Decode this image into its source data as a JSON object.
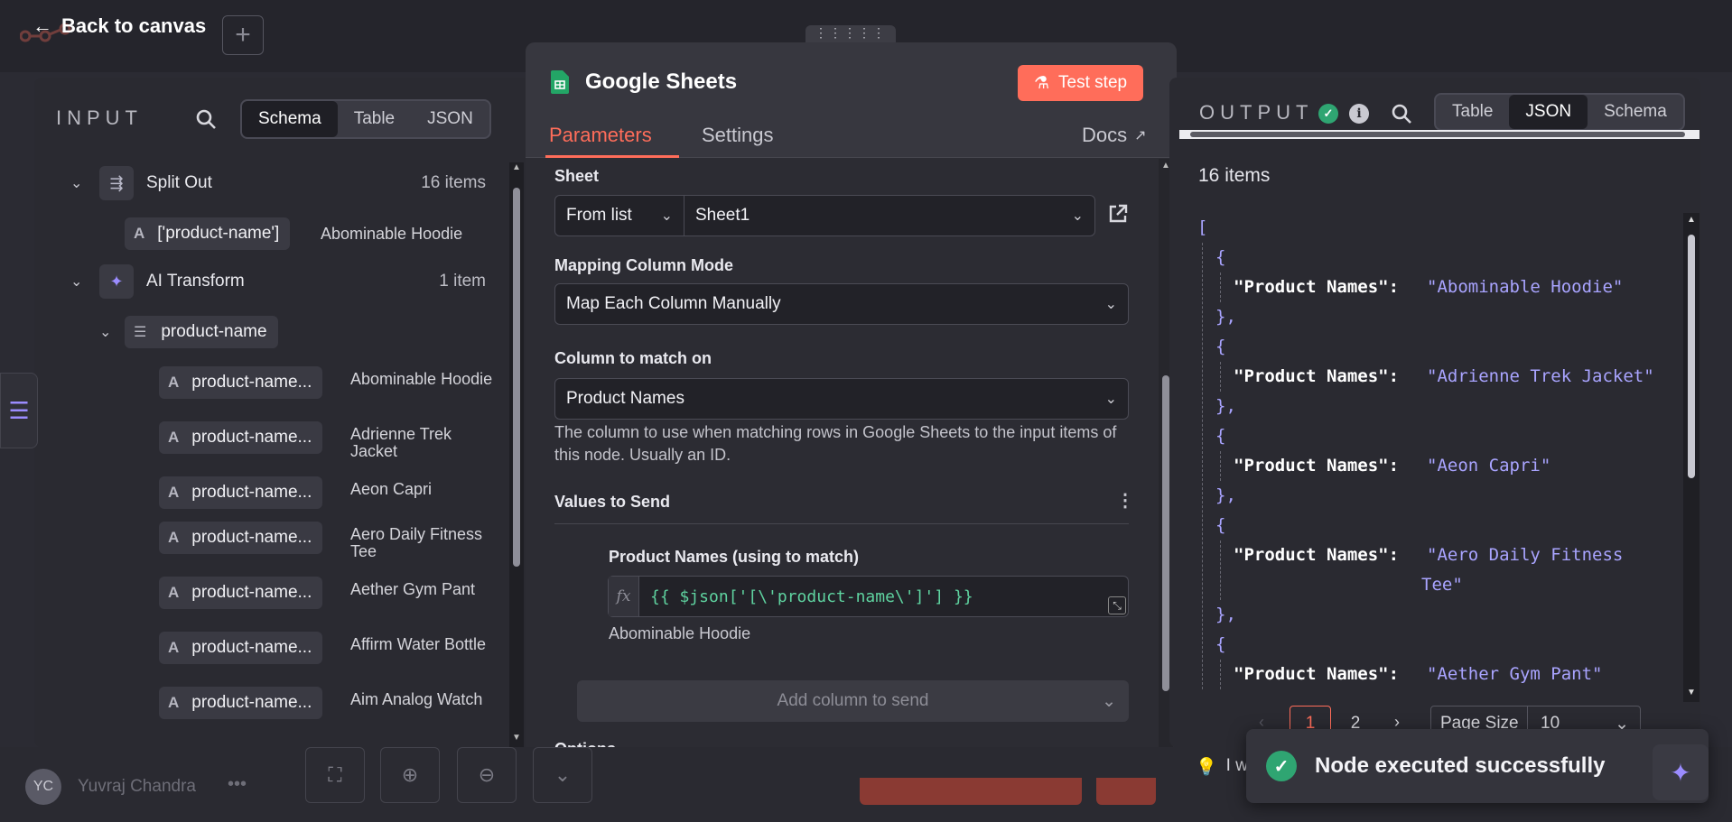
{
  "header": {
    "back_label": "Back to canvas",
    "logo_text": "n8n"
  },
  "input_panel": {
    "title": "INPUT",
    "views": [
      "Schema",
      "Table",
      "JSON"
    ],
    "active_view": "Schema",
    "split_out": {
      "label": "Split Out",
      "count": "16 items"
    },
    "split_field": {
      "type": "A",
      "name": "['product-name']",
      "value": "Abominable Hoodie"
    },
    "ai_transform": {
      "label": "AI Transform",
      "count": "1 item"
    },
    "product_group": "product-name",
    "items": [
      {
        "type": "A",
        "name": "product-name...",
        "value": "Abominable Hoodie"
      },
      {
        "type": "A",
        "name": "product-name...",
        "value": "Adrienne Trek Jacket"
      },
      {
        "type": "A",
        "name": "product-name...",
        "value": "Aeon Capri"
      },
      {
        "type": "A",
        "name": "product-name...",
        "value": "Aero Daily Fitness Tee"
      },
      {
        "type": "A",
        "name": "product-name...",
        "value": "Aether Gym Pant"
      },
      {
        "type": "A",
        "name": "product-name...",
        "value": "Affirm Water Bottle"
      },
      {
        "type": "A",
        "name": "product-name...",
        "value": "Aim Analog Watch"
      }
    ]
  },
  "modal": {
    "title": "Google Sheets",
    "test_step": "Test step",
    "tabs": [
      "Parameters",
      "Settings"
    ],
    "active_tab": "Parameters",
    "docs": "Docs",
    "sheet": {
      "label": "Sheet",
      "mode": "From list",
      "value": "Sheet1"
    },
    "mapping_mode": {
      "label": "Mapping Column Mode",
      "value": "Map Each Column Manually"
    },
    "match_column": {
      "label": "Column to match on",
      "value": "Product Names",
      "hint": "The column to use when matching rows in Google Sheets to the input items of this node. Usually an ID."
    },
    "values_to_send": {
      "label": "Values to Send",
      "field_label": "Product Names (using to match)",
      "expression": "{{ $json['[\\'product-name\\']'] }}",
      "preview": "Abominable Hoodie",
      "add_column": "Add column to send"
    },
    "options_label": "Options"
  },
  "output_panel": {
    "title": "OUTPUT",
    "views": [
      "Table",
      "JSON",
      "Schema"
    ],
    "active_view": "JSON",
    "count": "16 items",
    "records": [
      {
        "key": "\"Product Names\":",
        "value": "\"Abominable Hoodie\""
      },
      {
        "key": "\"Product Names\":",
        "value": "\"Adrienne Trek Jacket\""
      },
      {
        "key": "\"Product Names\":",
        "value": "\"Aeon Capri\""
      },
      {
        "key": "\"Product Names\":",
        "value": "\"Aero Daily Fitness",
        "value2": "Tee\""
      },
      {
        "key": "\"Product Names\":",
        "value": "\"Aether Gym Pant\""
      }
    ],
    "pager": {
      "pages": [
        "1",
        "2"
      ],
      "current": "1",
      "page_size_label": "Page Size",
      "page_size": "10"
    }
  },
  "toast": {
    "message": "Node executed successfully"
  },
  "footer": {
    "user_initials": "YC",
    "user_name": "Yuvraj Chandra",
    "hint_prefix": "I w"
  },
  "colors": {
    "accent": "#ff6d5a",
    "success": "#2fa572",
    "json_string": "#a9a4ff",
    "expression": "#5fd3a0"
  }
}
